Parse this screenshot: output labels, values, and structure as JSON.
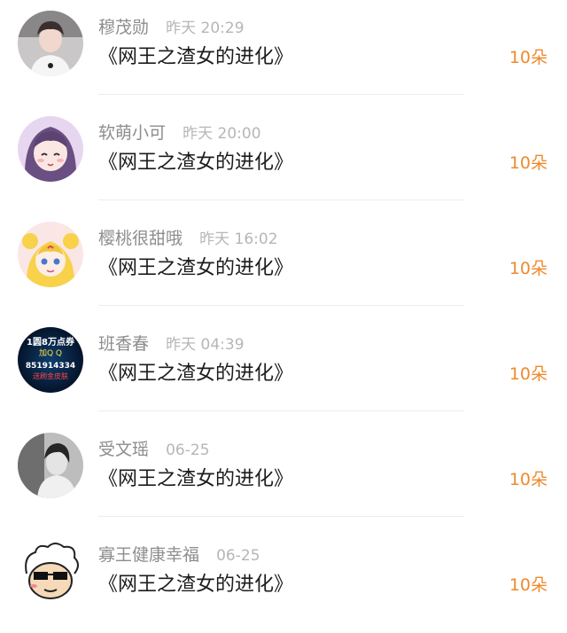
{
  "gifts": [
    {
      "name": "穆茂勋",
      "time": "昨天 20:29",
      "book": "《网王之渣女的进化》",
      "reward": "10朵",
      "avatar": "boy-photo-icon"
    },
    {
      "name": "软萌小可",
      "time": "昨天 20:00",
      "book": "《网王之渣女的进化》",
      "reward": "10朵",
      "avatar": "anime-girl-icon"
    },
    {
      "name": "樱桃很甜哦",
      "time": "昨天 16:02",
      "book": "《网王之渣女的进化》",
      "reward": "10朵",
      "avatar": "sailor-moon-icon"
    },
    {
      "name": "班香春",
      "time": "昨天 04:39",
      "book": "《网王之渣女的进化》",
      "reward": "10朵",
      "avatar": "ad-badge-icon",
      "avatar_text": [
        "1圆8万点券",
        "加Q Q",
        "851914334",
        "送刷金皮肤"
      ]
    },
    {
      "name": "受文瑶",
      "time": "06-25",
      "book": "《网王之渣女的进化》",
      "reward": "10朵",
      "avatar": "bw-photo-icon"
    },
    {
      "name": "寡王健康幸福",
      "time": "06-25",
      "book": "《网王之渣女的进化》",
      "reward": "10朵",
      "avatar": "cartoon-sunglasses-icon"
    }
  ],
  "colors": {
    "reward": "#ef8a2c",
    "name": "#8d8d8d",
    "time": "#b6b6b6",
    "title": "#1c1c1c"
  }
}
